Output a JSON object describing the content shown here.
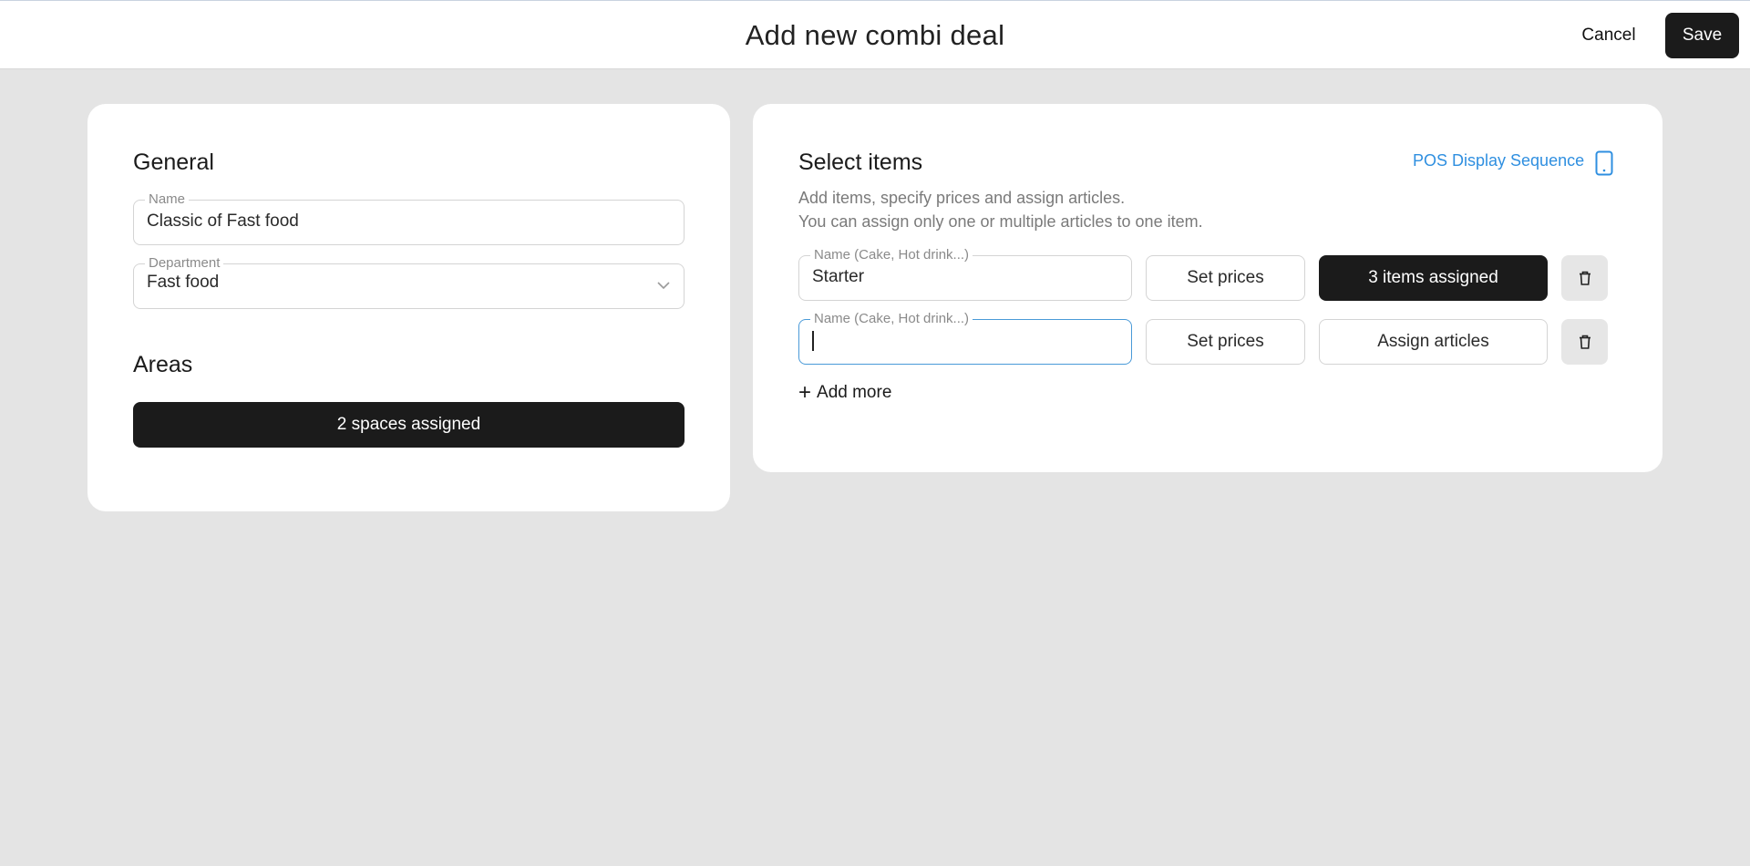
{
  "header": {
    "title": "Add new combi deal",
    "cancel_label": "Cancel",
    "save_label": "Save"
  },
  "general": {
    "title": "General",
    "name_field": {
      "label": "Name",
      "value": "Classic of Fast food"
    },
    "department_field": {
      "label": "Department",
      "value": "Fast food"
    }
  },
  "areas": {
    "title": "Areas",
    "assigned_label": "2 spaces assigned"
  },
  "select_items": {
    "title": "Select items",
    "pos_link": "POS Display Sequence",
    "description_line1": "Add items, specify prices and assign articles.",
    "description_line2": "You can assign only one or multiple articles to one item.",
    "rows": [
      {
        "name_label": "Name (Cake, Hot drink...)",
        "name_value": "Starter",
        "prices_label": "Set prices",
        "assign_label": "3 items assigned"
      },
      {
        "name_label": "Name (Cake, Hot drink...)",
        "name_value": "",
        "prices_label": "Set prices",
        "assign_label": "Assign articles"
      }
    ],
    "add_more_label": "Add more"
  },
  "colors": {
    "accent_link": "#2f8fe0",
    "dark_button": "#1b1b1b",
    "focus_border": "#4a9ad8",
    "page_background": "#e4e4e4"
  },
  "icons": [
    "chevron-down-icon",
    "mobile-phone-icon",
    "trash-icon",
    "plus-icon"
  ]
}
